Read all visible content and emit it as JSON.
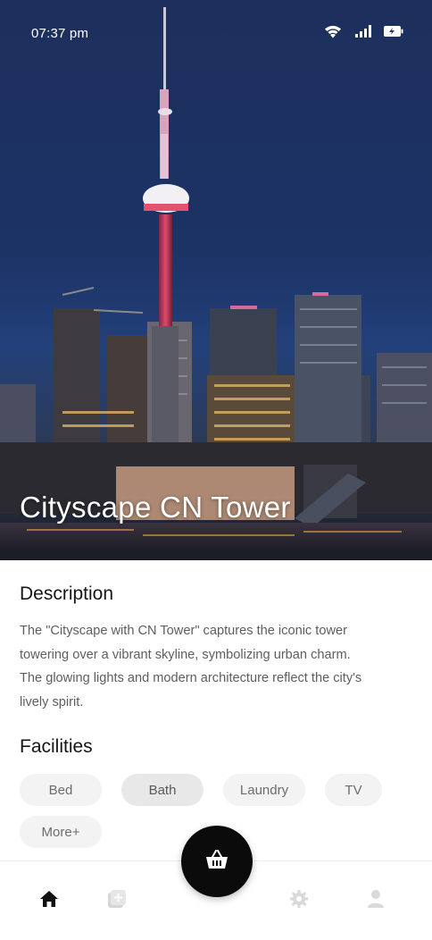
{
  "status_bar": {
    "time": "07:37 pm",
    "icons": [
      "wifi-icon",
      "signal-icon",
      "battery-charging-icon"
    ]
  },
  "hero": {
    "title": "Cityscape CN Tower"
  },
  "description": {
    "heading": "Description",
    "lines": [
      "The \"Cityscape with CN Tower\" captures the iconic tower",
      "towering over a vibrant skyline, symbolizing urban charm.",
      "The glowing lights and modern architecture reflect the city's",
      "lively spirit."
    ]
  },
  "facilities": {
    "heading": "Facilities",
    "items": [
      {
        "label": "Bed",
        "active": false
      },
      {
        "label": "Bath",
        "active": true
      },
      {
        "label": "Laundry",
        "active": false
      },
      {
        "label": "TV",
        "active": false
      },
      {
        "label": "More+",
        "active": false
      }
    ]
  },
  "bottom_nav": {
    "items": [
      {
        "icon": "home-icon",
        "active": true
      },
      {
        "icon": "add-box-icon",
        "active": false
      },
      {
        "icon": "settings-icon",
        "active": false
      },
      {
        "icon": "profile-icon",
        "active": false
      }
    ],
    "fab_icon": "basket-icon"
  },
  "colors": {
    "accent": "#0b0b0b",
    "chip_bg": "#f3f3f3",
    "text_muted": "#5e5e5e"
  }
}
